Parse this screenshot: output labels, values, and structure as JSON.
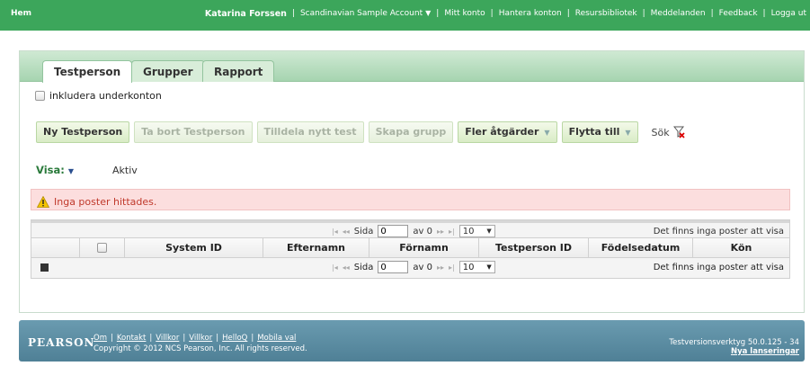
{
  "topbar": {
    "home": "Hem",
    "user": "Katarina Forssen",
    "account": "Scandinavian Sample Account",
    "links": [
      "Mitt konto",
      "Hantera konton",
      "Resursbibliotek",
      "Meddelanden",
      "Feedback",
      "Logga ut"
    ]
  },
  "tabs": [
    "Testperson",
    "Grupper",
    "Rapport"
  ],
  "include_subaccounts": "inkludera underkonton",
  "buttons": {
    "new": "Ny Testperson",
    "delete": "Ta bort Testperson",
    "assign": "Tilldela nytt test",
    "create_group": "Skapa grupp",
    "more_actions": "Fler åtgärder",
    "move_to": "Flytta till"
  },
  "search_label": "Sök",
  "view": {
    "label": "Visa:",
    "value": "Aktiv"
  },
  "alert": "Inga poster hittades.",
  "pager": {
    "page_label": "Sida",
    "page_value": "0",
    "of_label": "av 0",
    "rows": "10",
    "no_records": "Det finns inga poster att visa"
  },
  "columns": [
    "System ID",
    "Efternamn",
    "Förnamn",
    "Testperson ID",
    "Födelsedatum",
    "Kön"
  ],
  "footer": {
    "logo": "PEARSON",
    "links": [
      "Om",
      "Kontakt",
      "Villkor",
      "Villkor",
      "HelloQ",
      "Mobila val"
    ],
    "copyright": "Copyright © 2012 NCS Pearson, Inc. All rights reserved.",
    "version": "Testversionsverktyg 50.0.125 - 34",
    "news": "Nya lanseringar"
  },
  "colors": {
    "topbar": "#3ca65b",
    "accent_green": "#2a7a3b",
    "alert_bg": "#fcdede",
    "footer": "#5a8ca2"
  }
}
